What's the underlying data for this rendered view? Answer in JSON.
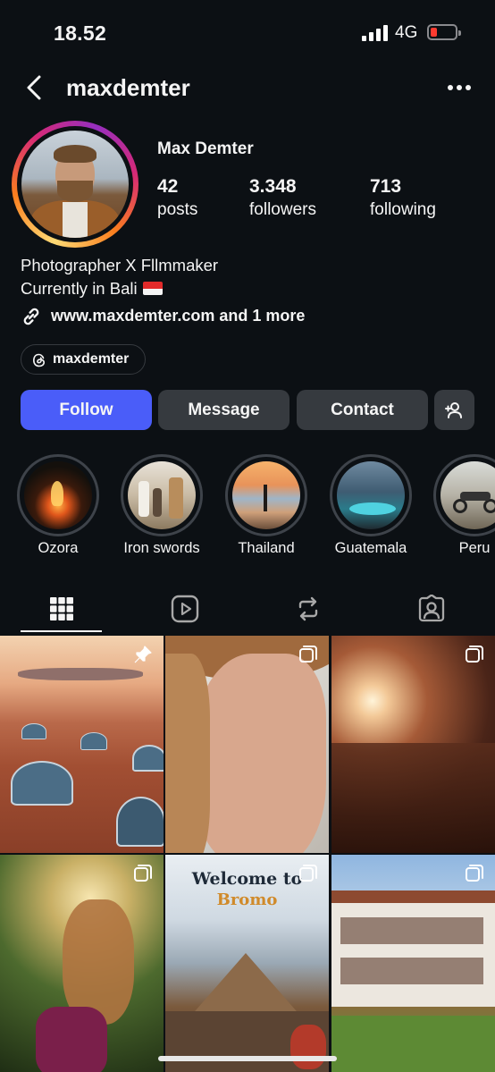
{
  "status_bar": {
    "time": "18.52",
    "network": "4G",
    "battery_color": "#ff3b30"
  },
  "header": {
    "username": "maxdemter",
    "back_icon": "chevron-left-icon",
    "more_icon": "more-horizontal-icon"
  },
  "profile": {
    "display_name": "Max Demter",
    "stats": [
      {
        "value": "42",
        "label": "posts"
      },
      {
        "value": "3.348",
        "label": "followers"
      },
      {
        "value": "713",
        "label": "following"
      }
    ],
    "bio_lines": [
      "Photographer X Fllmmaker",
      "Currently in Bali"
    ],
    "bio_flag": "indonesia-flag-icon",
    "link_text": "www.maxdemter.com and 1 more",
    "threads_handle": "maxdemter",
    "ring_gradient": [
      "#feda75",
      "#fa7e1e",
      "#d62976",
      "#962fbf"
    ]
  },
  "actions": {
    "follow": "Follow",
    "message": "Message",
    "contact": "Contact",
    "add_user_icon": "add-user-icon",
    "accent": "#4a5df9"
  },
  "highlights": [
    {
      "label": "Ozora"
    },
    {
      "label": "Iron swords"
    },
    {
      "label": "Thailand"
    },
    {
      "label": "Guatemala"
    },
    {
      "label": "Peru"
    }
  ],
  "tabs": [
    "grid-icon",
    "reels-icon",
    "reposts-icon",
    "tagged-icon"
  ],
  "posts": [
    {
      "badge": "pin-icon"
    },
    {
      "badge": "carousel-icon"
    },
    {
      "badge": "carousel-icon"
    },
    {
      "badge": "carousel-icon"
    },
    {
      "badge": "carousel-icon",
      "overlay_title": "Welcome to",
      "overlay_subtitle": "Bromo"
    },
    {
      "badge": "carousel-icon"
    }
  ]
}
